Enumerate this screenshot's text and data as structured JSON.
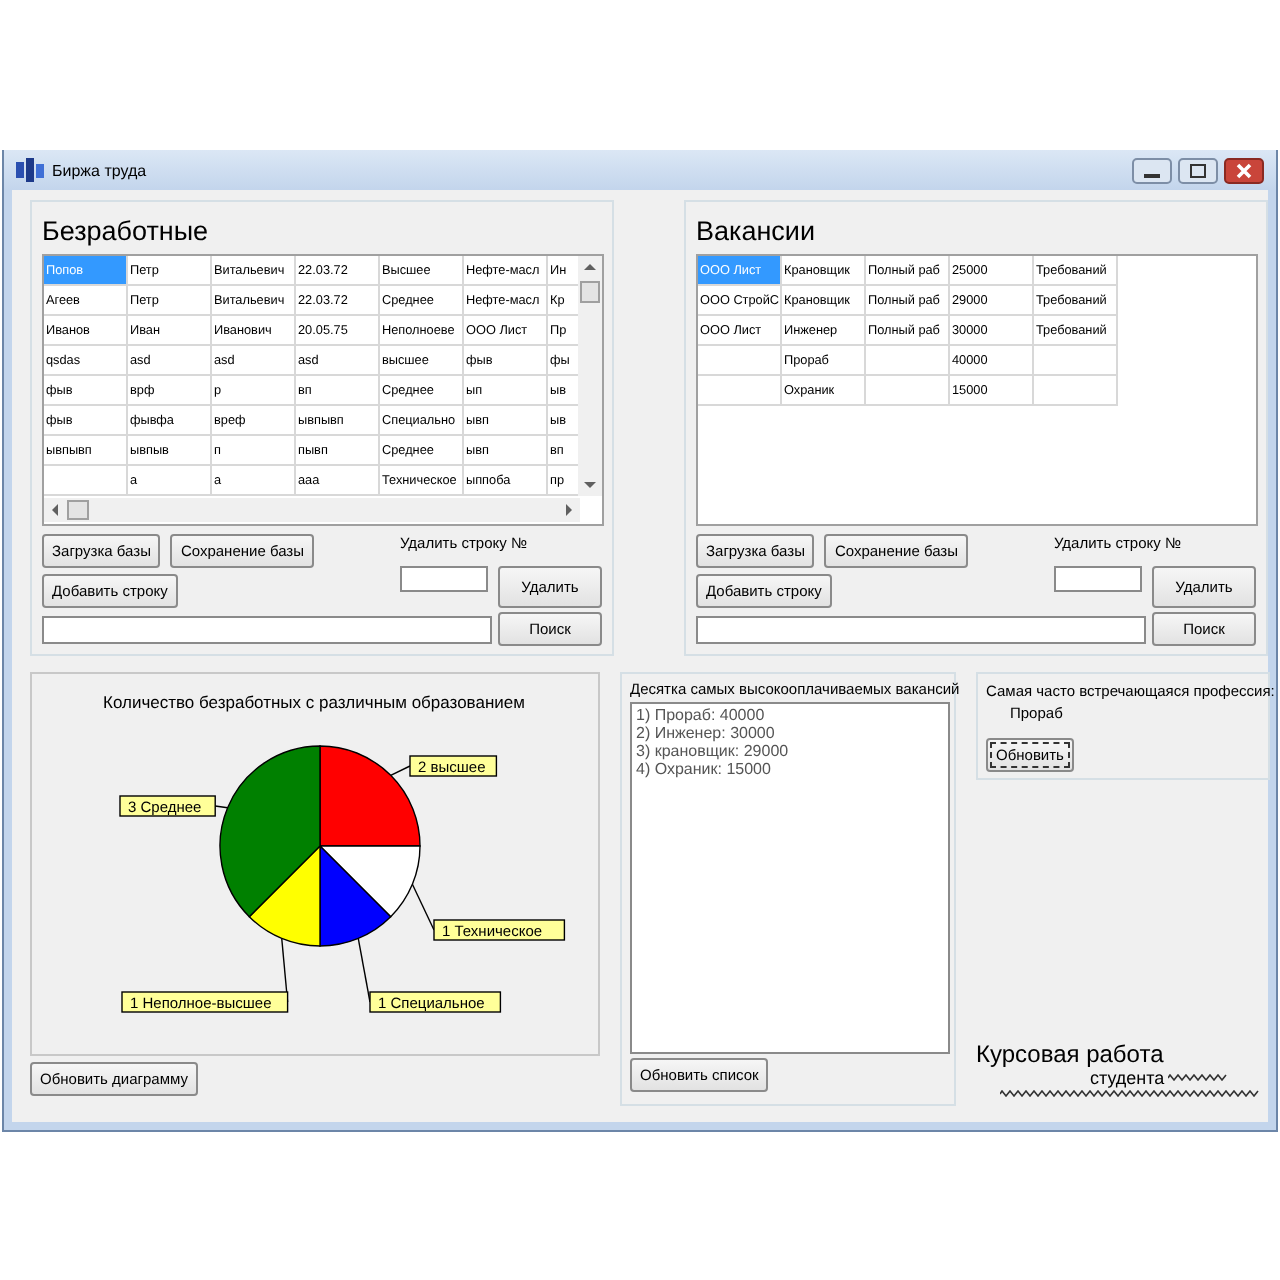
{
  "window": {
    "title": "Биржа труда"
  },
  "unemployed": {
    "title": "Безработные",
    "rows": [
      {
        "cells": [
          "Попов",
          "Петр",
          "Витальевич",
          "22.03.72",
          "Высшее",
          "Нефте-масл",
          "Ин"
        ],
        "selected": true
      },
      {
        "cells": [
          "Агеев",
          "Петр",
          "Витальевич",
          "22.03.72",
          "Среднее",
          "Нефте-масл",
          "Кр"
        ],
        "selected": false
      },
      {
        "cells": [
          "Иванов",
          "Иван",
          "Иванович",
          "20.05.75",
          "Неполноеве",
          "ООО Лист",
          "Пр"
        ],
        "selected": false
      },
      {
        "cells": [
          "qsdas",
          "asd",
          "asd",
          "asd",
          "высшее",
          "фыв",
          "фы"
        ],
        "selected": false
      },
      {
        "cells": [
          "фыв",
          "врф",
          "р",
          "вп",
          "Среднее",
          "ып",
          "ыв"
        ],
        "selected": false
      },
      {
        "cells": [
          "фыв",
          "фывфа",
          "вреф",
          "ывпывп",
          "Специально",
          "ывп",
          "ыв"
        ],
        "selected": false
      },
      {
        "cells": [
          "ывпывп",
          "ывпыв",
          "п",
          "пывп",
          "Среднее",
          "ывп",
          "вп"
        ],
        "selected": false
      },
      {
        "cells": [
          null,
          "а",
          "а",
          "ааа",
          "Техническое",
          "ыппоба",
          "пр"
        ],
        "selected": false
      }
    ],
    "load_button": "Загрузка базы",
    "save_button": "Сохранение базы",
    "add_button": "Добавить строку",
    "delete_label": "Удалить строку №",
    "delete_button": "Удалить",
    "search_button": "Поиск"
  },
  "vacancies": {
    "title": "Вакансии",
    "rows": [
      {
        "cells": [
          "ООО Лист",
          "Крановщик",
          "Полный раб",
          "25000",
          "Требований"
        ],
        "selected": true
      },
      {
        "cells": [
          "ООО СтройС",
          "Крановщик",
          "Полный раб",
          "29000",
          "Требований"
        ],
        "selected": false
      },
      {
        "cells": [
          "ООО Лист",
          "Инженер",
          "Полный раб",
          "30000",
          "Требований"
        ],
        "selected": false
      },
      {
        "cells": [
          null,
          "Прораб",
          null,
          "40000",
          null
        ],
        "selected": false
      },
      {
        "cells": [
          null,
          "Охраник",
          null,
          "15000",
          null
        ],
        "selected": false
      }
    ],
    "load_button": "Загрузка базы",
    "save_button": "Сохранение базы",
    "add_button": "Добавить строку",
    "delete_label": "Удалить строку №",
    "delete_button": "Удалить",
    "search_button": "Поиск"
  },
  "chart_panel": {
    "chart_data": {
      "type": "pie",
      "title": "Количество безработных с различным образованием",
      "categories": [
        "2 высшее",
        "1 Техническое",
        "1 Специальное",
        "1 Неполное-высшее",
        "3 Среднее"
      ],
      "values": [
        2,
        1,
        1,
        1,
        3
      ],
      "colors": [
        "#ff0000",
        "#ffffff",
        "#0000ff",
        "#ffff00",
        "#008000"
      ]
    },
    "refresh_button": "Обновить диаграмму"
  },
  "top_vacancies": {
    "label": "Десятка самых высокооплачиваемых вакансий",
    "items": [
      "1) Прораб: 40000",
      "2) Инженер: 30000",
      "3) крановщик: 29000",
      "4) Охраник: 15000"
    ],
    "refresh_button": "Обновить список"
  },
  "frequent_profession": {
    "label": "Самая часто встречающаяся профессия:",
    "value": "Прораб",
    "refresh_button": "Обновить"
  },
  "footer": {
    "title": "Курсовая работа",
    "subtitle": "студента"
  }
}
